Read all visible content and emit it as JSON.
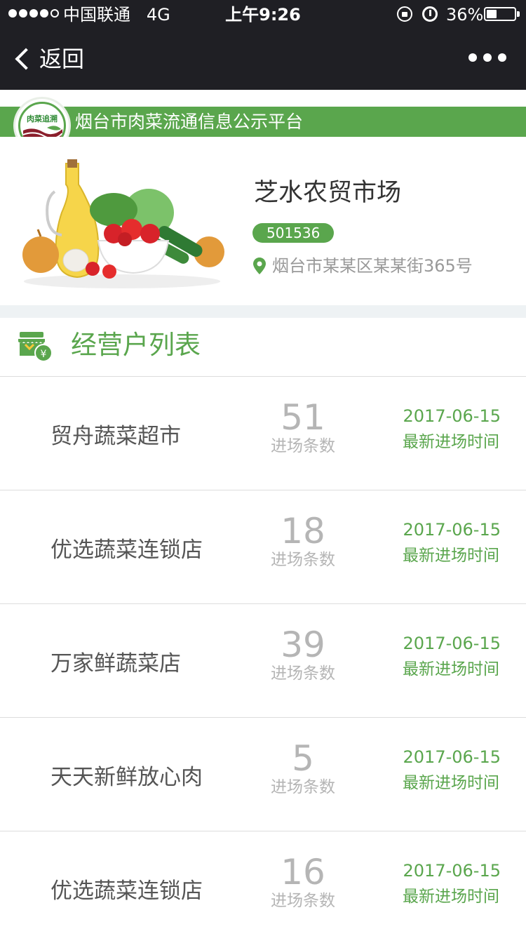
{
  "status_bar": {
    "carrier": "中国联通",
    "network": "4G",
    "time": "上午9:26",
    "battery": "36%",
    "battery_level": 0.36
  },
  "nav": {
    "back_label": "返回"
  },
  "platform": {
    "logo_text": "肉菜追溯",
    "title": "烟台市肉菜流通信息公示平台"
  },
  "market": {
    "name": "芝水农贸市场",
    "code": "501536",
    "address": "烟台市某某区某某街365号"
  },
  "section": {
    "title": "经营户列表"
  },
  "vendors": [
    {
      "name": "贸舟蔬菜超市",
      "count": "51",
      "count_label": "进场条数",
      "date": "2017-06-15",
      "date_label": "最新进场时间"
    },
    {
      "name": "优选蔬菜连锁店",
      "count": "18",
      "count_label": "进场条数",
      "date": "2017-06-15",
      "date_label": "最新进场时间"
    },
    {
      "name": "万家鲜蔬菜店",
      "count": "39",
      "count_label": "进场条数",
      "date": "2017-06-15",
      "date_label": "最新进场时间"
    },
    {
      "name": "天天新鲜放心肉",
      "count": "5",
      "count_label": "进场条数",
      "date": "2017-06-15",
      "date_label": "最新进场时间"
    },
    {
      "name": "优选蔬菜连锁店",
      "count": "16",
      "count_label": "进场条数",
      "date": "2017-06-15",
      "date_label": "最新进场时间"
    }
  ],
  "colors": {
    "accent": "#5aa64d",
    "bar": "#1f1f24"
  }
}
